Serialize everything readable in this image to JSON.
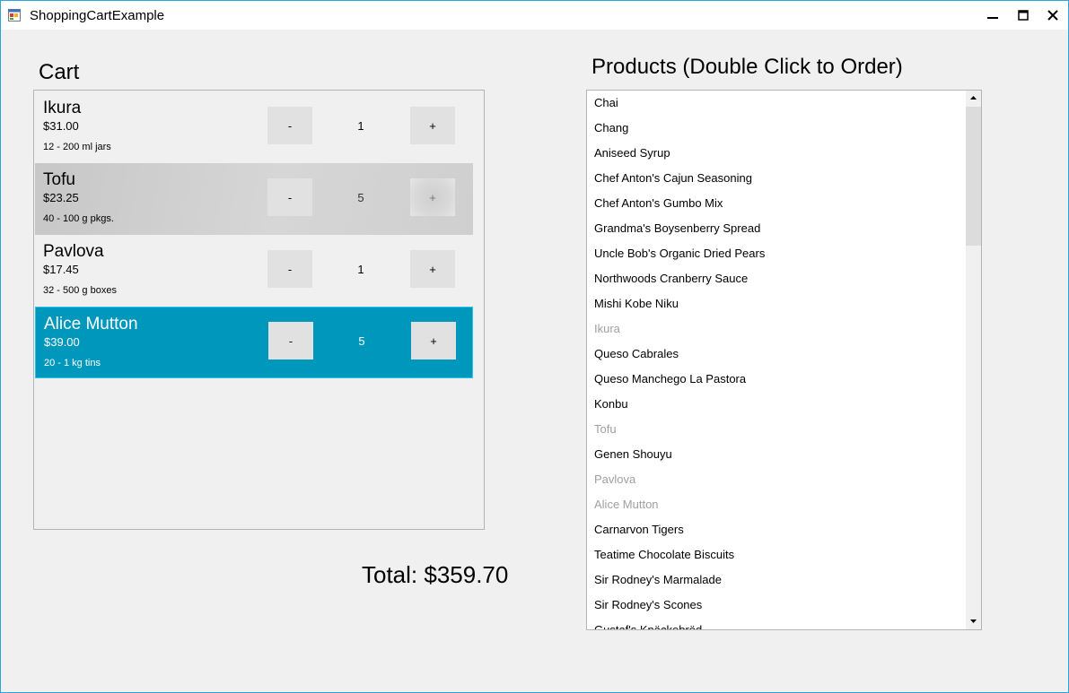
{
  "window": {
    "title": "ShoppingCartExample"
  },
  "icons": {
    "app": "app-window-icon",
    "minimize": "minimize-icon",
    "maximize": "maximize-icon",
    "close": "close-icon"
  },
  "cart": {
    "label": "Cart",
    "items": [
      {
        "name": "Ikura",
        "price": "$31.00",
        "quantity_per_unit": "12 - 200 ml jars",
        "qty": "1",
        "minus": "-",
        "plus": "+",
        "state": "normal"
      },
      {
        "name": "Tofu",
        "price": "$23.25",
        "quantity_per_unit": "40 - 100 g pkgs.",
        "qty": "5",
        "minus": "-",
        "plus": "+",
        "state": "hover"
      },
      {
        "name": "Pavlova",
        "price": "$17.45",
        "quantity_per_unit": "32 - 500 g boxes",
        "qty": "1",
        "minus": "-",
        "plus": "+",
        "state": "normal"
      },
      {
        "name": "Alice Mutton",
        "price": "$39.00",
        "quantity_per_unit": "20 - 1 kg tins",
        "qty": "5",
        "minus": "-",
        "plus": "+",
        "state": "selected"
      }
    ]
  },
  "total": {
    "text": "Total: $359.70"
  },
  "products": {
    "label": "Products (Double Click to Order)",
    "items": [
      {
        "name": "Chai",
        "disabled": false
      },
      {
        "name": "Chang",
        "disabled": false
      },
      {
        "name": "Aniseed Syrup",
        "disabled": false
      },
      {
        "name": "Chef Anton's Cajun Seasoning",
        "disabled": false
      },
      {
        "name": "Chef Anton's Gumbo Mix",
        "disabled": false
      },
      {
        "name": "Grandma's Boysenberry Spread",
        "disabled": false
      },
      {
        "name": "Uncle Bob's Organic Dried Pears",
        "disabled": false
      },
      {
        "name": "Northwoods Cranberry Sauce",
        "disabled": false
      },
      {
        "name": "Mishi Kobe Niku",
        "disabled": false
      },
      {
        "name": "Ikura",
        "disabled": true
      },
      {
        "name": "Queso Cabrales",
        "disabled": false
      },
      {
        "name": "Queso Manchego La Pastora",
        "disabled": false
      },
      {
        "name": "Konbu",
        "disabled": false
      },
      {
        "name": "Tofu",
        "disabled": true
      },
      {
        "name": "Genen Shouyu",
        "disabled": false
      },
      {
        "name": "Pavlova",
        "disabled": true
      },
      {
        "name": "Alice Mutton",
        "disabled": true
      },
      {
        "name": "Carnarvon Tigers",
        "disabled": false
      },
      {
        "name": "Teatime Chocolate Biscuits",
        "disabled": false
      },
      {
        "name": "Sir Rodney's Marmalade",
        "disabled": false
      },
      {
        "name": "Sir Rodney's Scones",
        "disabled": false
      },
      {
        "name": "Gustaf's Knäckebröd",
        "disabled": false
      }
    ]
  },
  "colors": {
    "selected": "#0097bc",
    "selected_border": "#24c6ee",
    "hover": "#c9c9c9",
    "disabled_text": "#a0a0a0",
    "window_border": "#2aa6d8"
  }
}
